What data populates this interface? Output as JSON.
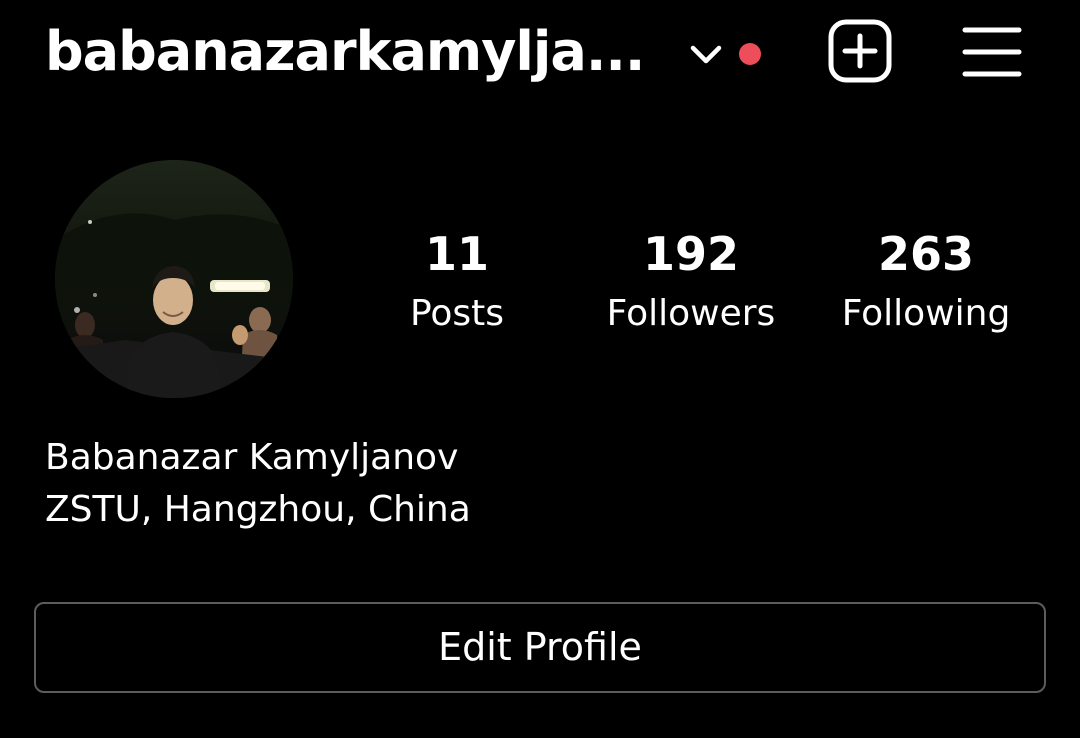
{
  "header": {
    "username": "babanazarkamylja...",
    "switch_icon": "chevron-down-icon",
    "notification_dot_color": "#ee4d5a",
    "create_icon": "plus-square-icon",
    "menu_icon": "hamburger-menu-icon"
  },
  "profile": {
    "avatar_icon": "profile-photo",
    "stats": {
      "posts": {
        "value": "11",
        "label": "Posts"
      },
      "followers": {
        "value": "192",
        "label": "Followers"
      },
      "following": {
        "value": "263",
        "label": "Following"
      }
    },
    "full_name": "Babanazar Kamyljanov",
    "bio": "ZSTU, Hangzhou, China"
  },
  "actions": {
    "edit_profile_label": "Edit Profile"
  },
  "colors": {
    "background": "#000000",
    "text": "#ffffff",
    "button_border": "#5c5c5c"
  }
}
